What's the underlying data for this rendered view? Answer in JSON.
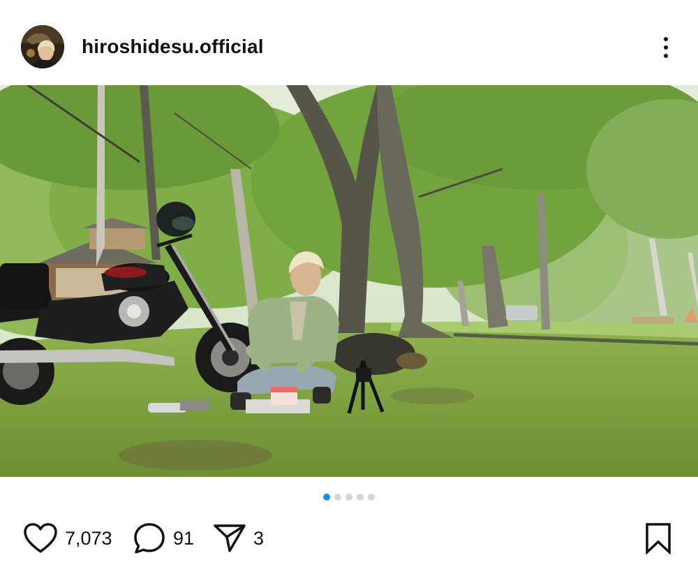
{
  "post": {
    "username": "hiroshidesu.official",
    "avatar_icon": "profile-photo-avatar",
    "more_icon": "more-vertical-icon",
    "photo_description_icon": "post-photo",
    "carousel": {
      "total": 5,
      "active_index": 0,
      "active_color": "#1890f0",
      "inactive_color": "#d7d7d7"
    },
    "actions": {
      "like_count": "7,073",
      "comment_count": "91",
      "share_count": "3",
      "like_icon": "heart-icon",
      "comment_icon": "comment-bubble-icon",
      "share_icon": "paper-plane-icon",
      "bookmark_icon": "bookmark-icon"
    }
  }
}
